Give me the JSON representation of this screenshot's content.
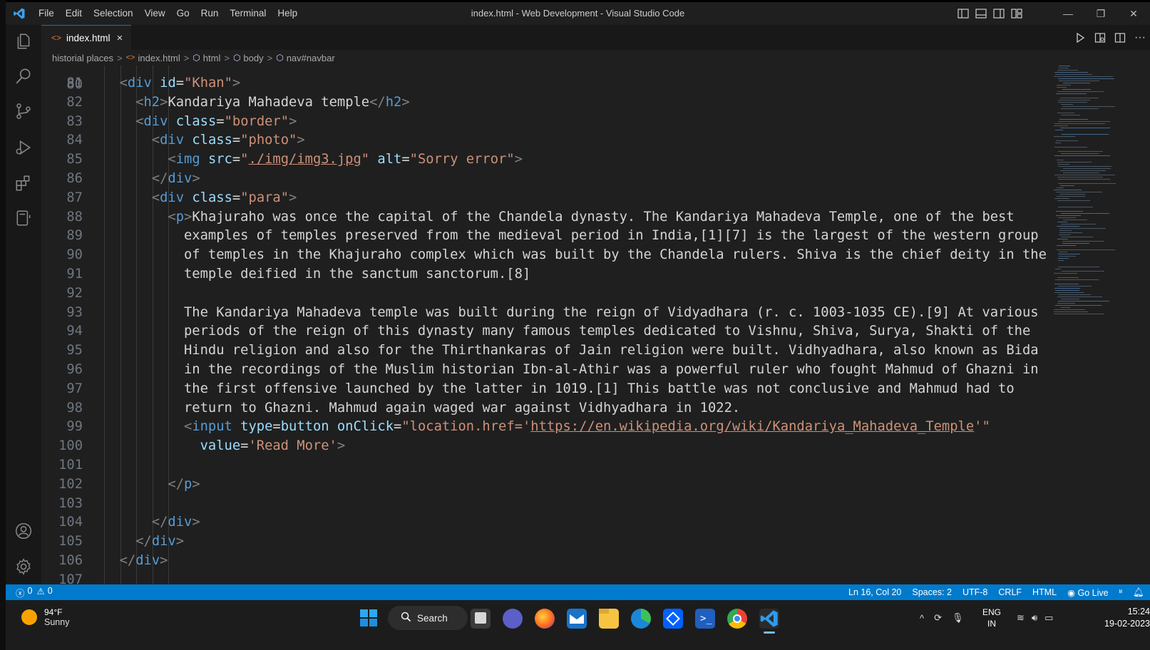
{
  "window": {
    "title": "index.html - Web Development - Visual Studio Code",
    "menu": [
      "File",
      "Edit",
      "Selection",
      "View",
      "Go",
      "Run",
      "Terminal",
      "Help"
    ],
    "controls": [
      "minimize-icon",
      "maximize-icon",
      "close-icon"
    ]
  },
  "activity_bar": [
    "explorer-icon",
    "search-icon",
    "source-control-icon",
    "run-debug-icon",
    "extensions-icon",
    "remote-explorer-icon",
    "accounts-icon",
    "settings-gear-icon"
  ],
  "tab": {
    "label": "index.html",
    "close": "×"
  },
  "breadcrumb": {
    "folder": "historial places",
    "file": "index.html",
    "items": [
      "html",
      "body",
      "nav#navbar"
    ],
    "sep": ">"
  },
  "editor": {
    "first_line": 80,
    "lines": [
      {
        "n": "81",
        "indent": 1,
        "seg": [
          [
            "t",
            "<"
          ],
          [
            "tn",
            "div"
          ],
          [
            "sp",
            " "
          ],
          [
            "an",
            "id"
          ],
          [
            "txt",
            "="
          ],
          [
            "av",
            "\"Khan\""
          ],
          [
            "t",
            ">"
          ]
        ]
      },
      {
        "n": "82",
        "indent": 2,
        "seg": [
          [
            "t",
            "<"
          ],
          [
            "tn",
            "h2"
          ],
          [
            "t",
            ">"
          ],
          [
            "txt",
            "Kandariya Mahadeva temple"
          ],
          [
            "t",
            "</"
          ],
          [
            "tn",
            "h2"
          ],
          [
            "t",
            ">"
          ]
        ]
      },
      {
        "n": "83",
        "indent": 2,
        "seg": [
          [
            "t",
            "<"
          ],
          [
            "tn",
            "div"
          ],
          [
            "sp",
            " "
          ],
          [
            "an",
            "class"
          ],
          [
            "txt",
            "="
          ],
          [
            "av",
            "\"border\""
          ],
          [
            "t",
            ">"
          ]
        ]
      },
      {
        "n": "84",
        "indent": 3,
        "seg": [
          [
            "t",
            "<"
          ],
          [
            "tn",
            "div"
          ],
          [
            "sp",
            " "
          ],
          [
            "an",
            "class"
          ],
          [
            "txt",
            "="
          ],
          [
            "av",
            "\"photo\""
          ],
          [
            "t",
            ">"
          ]
        ]
      },
      {
        "n": "85",
        "indent": 4,
        "seg": [
          [
            "t",
            "<"
          ],
          [
            "tn",
            "img"
          ],
          [
            "sp",
            " "
          ],
          [
            "an",
            "src"
          ],
          [
            "txt",
            "="
          ],
          [
            "av",
            "\""
          ],
          [
            "avu",
            "./img/img3.jpg"
          ],
          [
            "av",
            "\""
          ],
          [
            "sp",
            " "
          ],
          [
            "an",
            "alt"
          ],
          [
            "txt",
            "="
          ],
          [
            "av",
            "\"Sorry error\""
          ],
          [
            "t",
            ">"
          ]
        ]
      },
      {
        "n": "86",
        "indent": 3,
        "seg": [
          [
            "t",
            "</"
          ],
          [
            "tn",
            "div"
          ],
          [
            "t",
            ">"
          ]
        ]
      },
      {
        "n": "87",
        "indent": 3,
        "seg": [
          [
            "t",
            "<"
          ],
          [
            "tn",
            "div"
          ],
          [
            "sp",
            " "
          ],
          [
            "an",
            "class"
          ],
          [
            "txt",
            "="
          ],
          [
            "av",
            "\"para\""
          ],
          [
            "t",
            ">"
          ]
        ]
      },
      {
        "n": "88",
        "indent": 4,
        "seg": [
          [
            "t",
            "<"
          ],
          [
            "tn",
            "p"
          ],
          [
            "t",
            ">"
          ],
          [
            "txt",
            "Khajuraho was once the capital of the Chandela dynasty. The Kandariya Mahadeva Temple, one of the best"
          ]
        ]
      },
      {
        "n": "89",
        "indent": 5,
        "seg": [
          [
            "txt",
            "examples of temples preserved from the medieval period in India,[1][7] is the largest of the western group"
          ]
        ]
      },
      {
        "n": "90",
        "indent": 5,
        "seg": [
          [
            "txt",
            "of temples in the Khajuraho complex which was built by the Chandela rulers. Shiva is the chief deity in the"
          ]
        ]
      },
      {
        "n": "91",
        "indent": 5,
        "seg": [
          [
            "txt",
            "temple deified in the sanctum sanctorum.[8]"
          ]
        ]
      },
      {
        "n": "92",
        "indent": 5,
        "seg": []
      },
      {
        "n": "93",
        "indent": 5,
        "seg": [
          [
            "txt",
            "The Kandariya Mahadeva temple was built during the reign of Vidyadhara (r. c. 1003-1035 CE).[9] At various"
          ]
        ]
      },
      {
        "n": "94",
        "indent": 5,
        "seg": [
          [
            "txt",
            "periods of the reign of this dynasty many famous temples dedicated to Vishnu, Shiva, Surya, Shakti of the"
          ]
        ]
      },
      {
        "n": "95",
        "indent": 5,
        "seg": [
          [
            "txt",
            "Hindu religion and also for the Thirthankaras of Jain religion were built. Vidhyadhara, also known as Bida"
          ]
        ]
      },
      {
        "n": "96",
        "indent": 5,
        "seg": [
          [
            "txt",
            "in the recordings of the Muslim historian Ibn-al-Athir was a powerful ruler who fought Mahmud of Ghazni in"
          ]
        ]
      },
      {
        "n": "97",
        "indent": 5,
        "seg": [
          [
            "txt",
            "the first offensive launched by the latter in 1019.[1] This battle was not conclusive and Mahmud had to"
          ]
        ]
      },
      {
        "n": "98",
        "indent": 5,
        "seg": [
          [
            "txt",
            "return to Ghazni. Mahmud again waged war against Vidhyadhara in 1022."
          ]
        ]
      },
      {
        "n": "99",
        "indent": 5,
        "seg": [
          [
            "t",
            "<"
          ],
          [
            "tn",
            "input"
          ],
          [
            "sp",
            " "
          ],
          [
            "an",
            "type"
          ],
          [
            "txt",
            "="
          ],
          [
            "an",
            "button"
          ],
          [
            "sp",
            " "
          ],
          [
            "an",
            "onClick"
          ],
          [
            "txt",
            "="
          ],
          [
            "av",
            "\"location.href='"
          ],
          [
            "avu",
            "https://en.wikipedia.org/wiki/Kandariya_Mahadeva_Temple"
          ],
          [
            "av",
            "'\""
          ]
        ]
      },
      {
        "n": "100",
        "indent": 6,
        "seg": [
          [
            "an",
            "value"
          ],
          [
            "txt",
            "="
          ],
          [
            "av",
            "'Read More'"
          ],
          [
            "t",
            ">"
          ]
        ]
      },
      {
        "n": "101",
        "indent": 5,
        "seg": []
      },
      {
        "n": "102",
        "indent": 4,
        "seg": [
          [
            "t",
            "</"
          ],
          [
            "tn",
            "p"
          ],
          [
            "t",
            ">"
          ]
        ]
      },
      {
        "n": "103",
        "indent": 4,
        "seg": []
      },
      {
        "n": "104",
        "indent": 3,
        "seg": [
          [
            "t",
            "</"
          ],
          [
            "tn",
            "div"
          ],
          [
            "t",
            ">"
          ]
        ]
      },
      {
        "n": "105",
        "indent": 2,
        "seg": [
          [
            "t",
            "</"
          ],
          [
            "tn",
            "div"
          ],
          [
            "t",
            ">"
          ]
        ]
      },
      {
        "n": "106",
        "indent": 1,
        "seg": [
          [
            "t",
            "</"
          ],
          [
            "tn",
            "div"
          ],
          [
            "t",
            ">"
          ]
        ]
      },
      {
        "n": "107",
        "indent": 0,
        "seg": []
      }
    ]
  },
  "status_bar": {
    "errors": "0",
    "warnings": "0",
    "position": "Ln 16, Col 20",
    "spaces": "Spaces: 2",
    "encoding": "UTF-8",
    "eol": "CRLF",
    "language": "HTML",
    "go_live": "Go Live"
  },
  "taskbar": {
    "weather_temp": "94°F",
    "weather_desc": "Sunny",
    "search_label": "Search",
    "lang_top": "ENG",
    "lang_bottom": "IN",
    "time": "15:24",
    "date": "19-02-2023"
  },
  "colors": {
    "accent": "#007acc",
    "editor_bg": "#1f1f1f",
    "tag": "#569cd6",
    "attr": "#9cdcfe",
    "string": "#ce9178"
  }
}
